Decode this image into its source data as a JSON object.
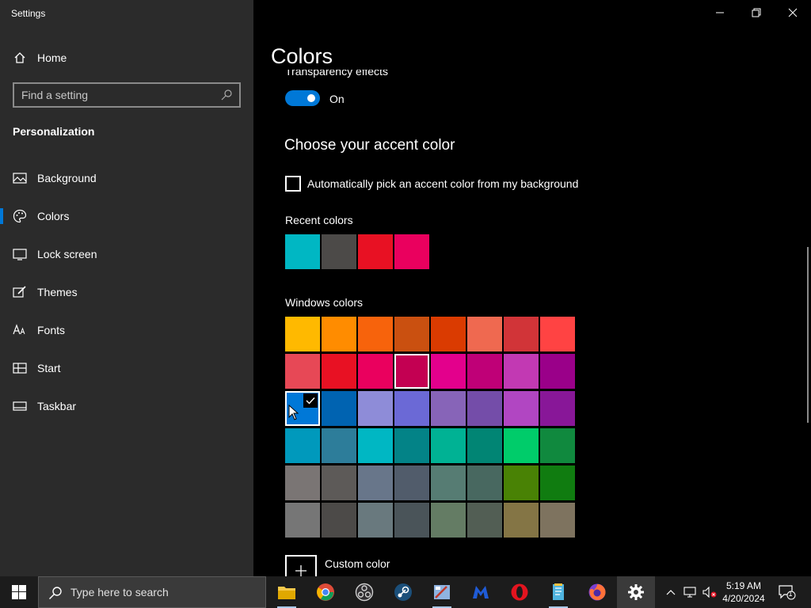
{
  "window": {
    "title": "Settings",
    "controls": [
      "minimize",
      "restore",
      "close"
    ]
  },
  "sidebar": {
    "home_label": "Home",
    "search_placeholder": "Find a setting",
    "section_heading": "Personalization",
    "items": [
      {
        "label": "Background",
        "icon": "picture-icon"
      },
      {
        "label": "Colors",
        "icon": "palette-icon",
        "active": true
      },
      {
        "label": "Lock screen",
        "icon": "lock-screen-icon"
      },
      {
        "label": "Themes",
        "icon": "brush-icon"
      },
      {
        "label": "Fonts",
        "icon": "font-icon"
      },
      {
        "label": "Start",
        "icon": "start-layout-icon"
      },
      {
        "label": "Taskbar",
        "icon": "taskbar-icon"
      }
    ]
  },
  "main": {
    "title": "Colors",
    "transparency": {
      "label": "Transparency effects",
      "state": "On",
      "on": true
    },
    "accent_heading": "Choose your accent color",
    "auto_pick_label": "Automatically pick an accent color from my background",
    "auto_pick_checked": false,
    "recent_label": "Recent colors",
    "recent_colors": [
      "#00b7c3",
      "#4c4a48",
      "#e81123",
      "#ea005e"
    ],
    "windows_label": "Windows colors",
    "windows_colors": [
      [
        "#ffb900",
        "#ff8c00",
        "#f7630c",
        "#ca5010",
        "#da3b01",
        "#ef6950",
        "#d13438",
        "#ff4343"
      ],
      [
        "#e74856",
        "#e81123",
        "#ea005e",
        "#c30052",
        "#e3008c",
        "#bf0077",
        "#c239b3",
        "#9a0089"
      ],
      [
        "#0078d7",
        "#0063b1",
        "#8e8cd8",
        "#6b69d6",
        "#8764b8",
        "#744da9",
        "#b146c2",
        "#881798"
      ],
      [
        "#0099bc",
        "#2d7d9a",
        "#00b7c3",
        "#038387",
        "#00b294",
        "#018574",
        "#00cc6a",
        "#10893e"
      ],
      [
        "#7a7574",
        "#5d5a58",
        "#68768a",
        "#515c6b",
        "#567c73",
        "#486860",
        "#498205",
        "#107c10"
      ],
      [
        "#767676",
        "#4c4a48",
        "#69797e",
        "#4a5459",
        "#647c64",
        "#525e54",
        "#847545",
        "#7e735f"
      ]
    ],
    "selected_color": "#0078d7",
    "highlighted_color": "#c30052",
    "custom_color_label": "Custom color"
  },
  "taskbar": {
    "search_placeholder": "Type here to search",
    "apps": [
      {
        "name": "file-explorer-icon",
        "color": "#f6c94a"
      },
      {
        "name": "chrome-icon",
        "color": "#dd4b39"
      },
      {
        "name": "obs-icon",
        "color": "#cfcfcf"
      },
      {
        "name": "steam-icon",
        "color": "#1b4f7a"
      },
      {
        "name": "paint-app-icon",
        "color": "#8fb3e0"
      },
      {
        "name": "malwarebytes-icon",
        "color": "#1f5bd6"
      },
      {
        "name": "opera-icon",
        "color": "#e3141f"
      },
      {
        "name": "notepad-app-icon",
        "color": "#4fb4e0"
      },
      {
        "name": "firefox-icon",
        "color": "#ff7139"
      },
      {
        "name": "settings-gear-icon",
        "color": "#ffffff"
      }
    ],
    "time": "5:19 AM",
    "date": "4/20/2024",
    "notification_count": "1"
  }
}
